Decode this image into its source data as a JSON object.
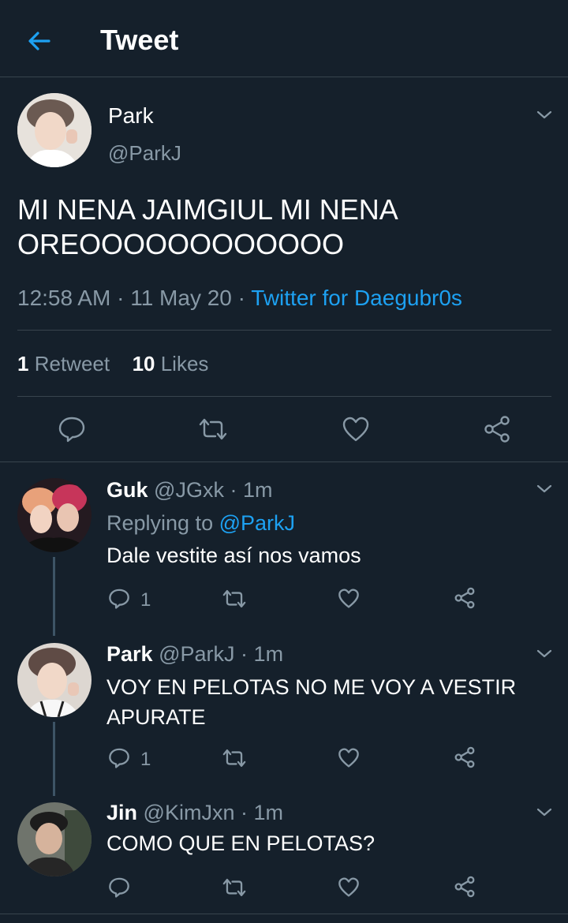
{
  "header": {
    "title": "Tweet"
  },
  "tweet": {
    "name": "Park",
    "handle": "@ParkJ",
    "text_line1": "MI NENA JAIMGIUL MI NENA",
    "text_line2": "OREOOOOOOOOOOOO",
    "time": "12:58 AM",
    "sep1": "·",
    "date": "11 May 20",
    "sep2": "·",
    "source": "Twitter for Daegubr0s",
    "retweets_count": "1",
    "retweets_label": "Retweet",
    "likes_count": "10",
    "likes_label": "Likes"
  },
  "replies": [
    {
      "name": "Guk",
      "handle": "@JGxk",
      "sep": "·",
      "time": "1m",
      "replying_prefix": "Replying to",
      "replying_to": "@ParkJ",
      "text": "Dale vestite así nos vamos",
      "reply_count": "1",
      "avatar_bg": "#2a1d24"
    },
    {
      "name": "Park",
      "handle": "@ParkJ",
      "sep": "·",
      "time": "1m",
      "text_line1": "VOY EN PELOTAS NO ME VOY A VESTIR",
      "text_line2": "APURATE",
      "reply_count": "1",
      "avatar_bg": "#d9d4cf"
    },
    {
      "name": "Jin",
      "handle": "@KimJxn",
      "sep": "·",
      "time": "1m",
      "text": "COMO QUE EN PELOTAS?",
      "reply_count": "",
      "avatar_bg": "#5a5f58"
    }
  ],
  "colors": {
    "background": "#15202b",
    "accent": "#1da1f2",
    "muted": "#8899a6",
    "divider": "#38444d"
  },
  "icons": [
    "back-arrow-icon",
    "chevron-down-icon",
    "reply-icon",
    "retweet-icon",
    "like-icon",
    "share-icon"
  ]
}
